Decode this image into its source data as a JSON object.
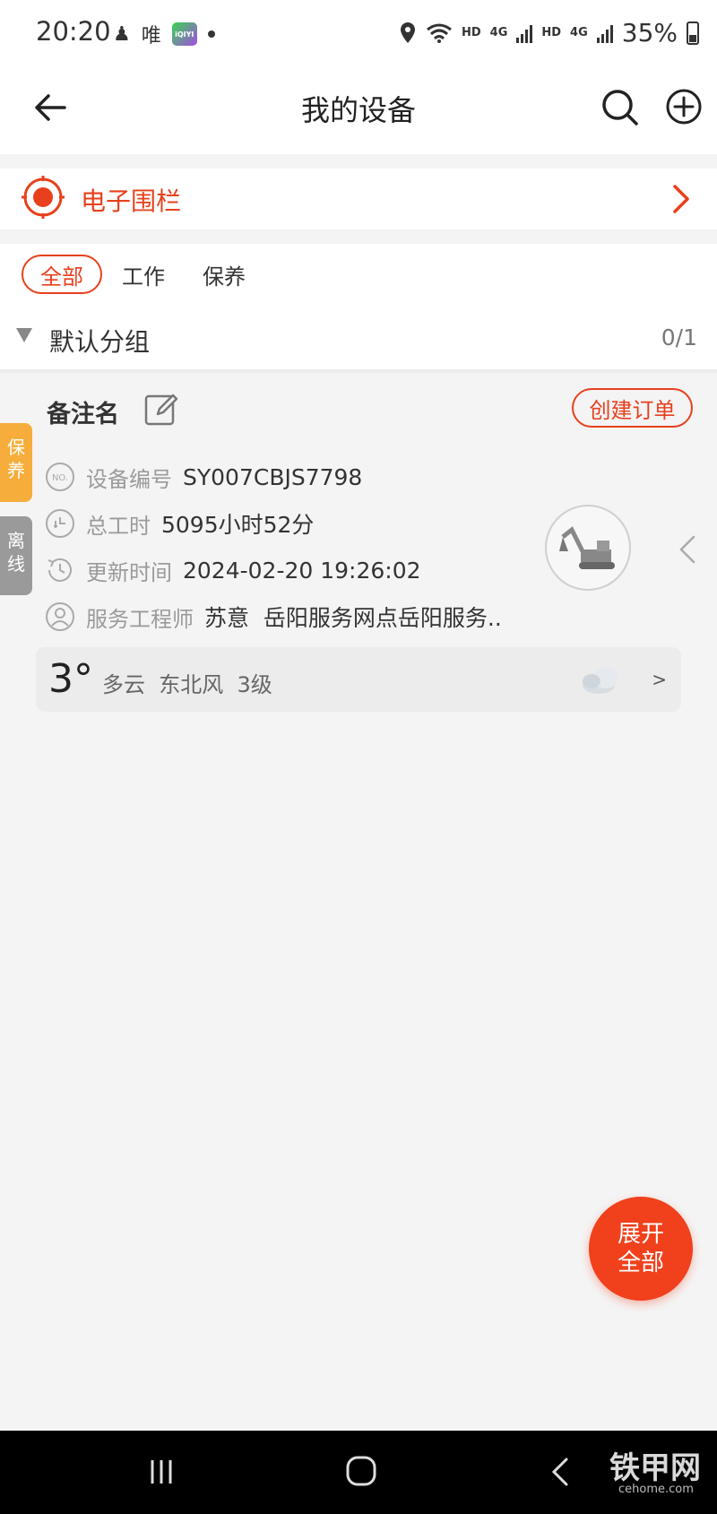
{
  "status_bar": {
    "time": "20:20",
    "app_text": "唯",
    "iqiyi_label": "iQIYI",
    "hd1": "HD",
    "net1": "4G",
    "hd2": "HD",
    "net2": "4G",
    "battery": "35%"
  },
  "header": {
    "title": "我的设备"
  },
  "fence": {
    "label": "电子围栏"
  },
  "filters": {
    "tabs": [
      {
        "label": "全部",
        "active": true
      },
      {
        "label": "工作",
        "active": false
      },
      {
        "label": "保养",
        "active": false
      }
    ]
  },
  "group": {
    "name": "默认分组",
    "count": "0/1"
  },
  "side_tags": {
    "maintenance": "保\n养",
    "offline": "离\n线"
  },
  "device": {
    "name": "备注名",
    "create_order": "创建订单",
    "rows": [
      {
        "key": "设备编号",
        "value": "SY007CBJS7798"
      },
      {
        "key": "总工时",
        "value": "5095小时52分"
      },
      {
        "key": "更新时间",
        "value": "2024-02-20 19:26:02"
      },
      {
        "key": "服务工程师",
        "value": "苏意  岳阳服务网点岳阳服务.."
      }
    ],
    "no_badge": "NO."
  },
  "weather": {
    "temperature": "3°",
    "description": "多云  东北风  3级",
    "more": ">"
  },
  "fab": {
    "line1": "展开",
    "line2": "全部"
  },
  "watermark": {
    "text": "铁甲网",
    "sub": "cehome.com"
  },
  "colors": {
    "accent": "#e8401c",
    "maintenance_tag": "#f6ad3b",
    "offline_tag": "#9a9a9a"
  }
}
